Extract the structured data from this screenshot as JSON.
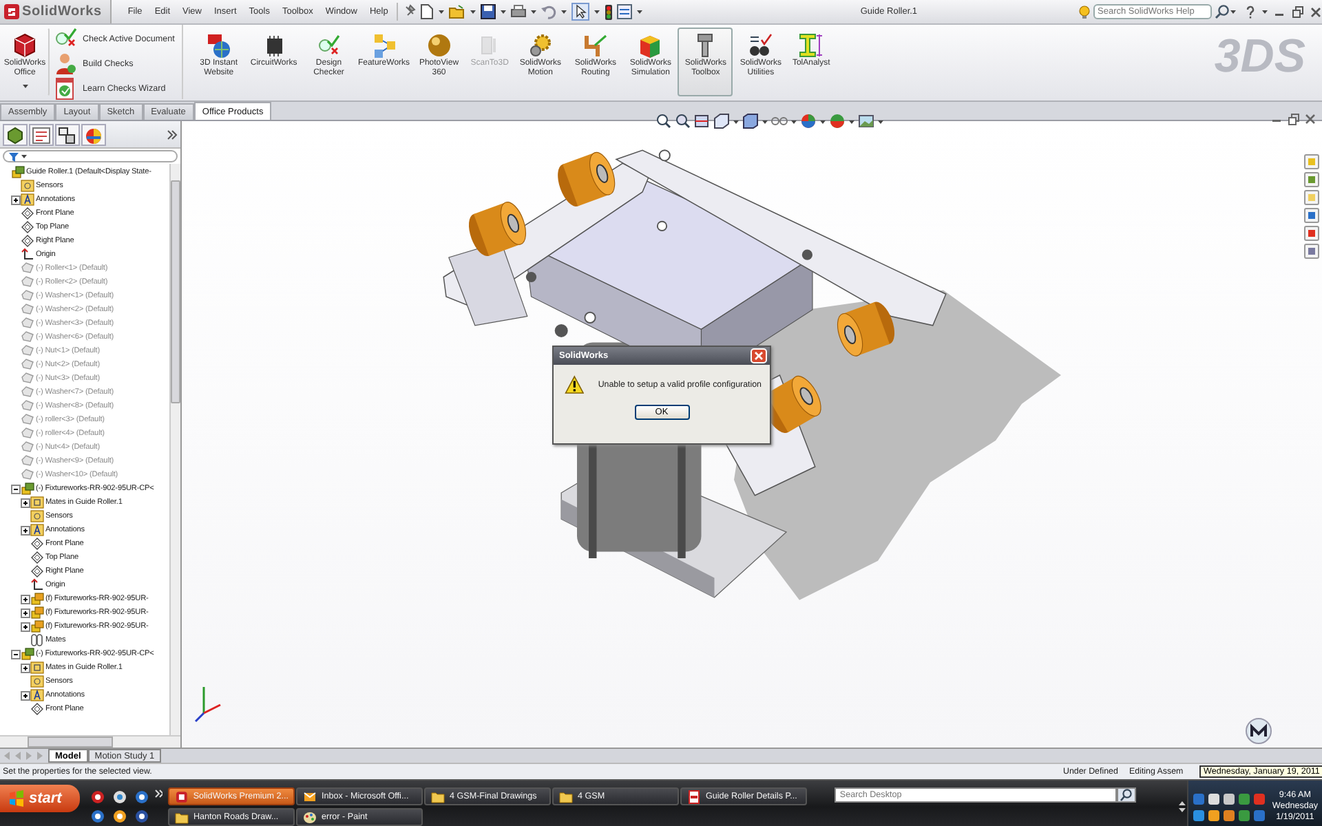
{
  "title_bar": {
    "app_name": "SolidWorks",
    "menu": [
      "File",
      "Edit",
      "View",
      "Insert",
      "Tools",
      "Toolbox",
      "Window",
      "Help"
    ],
    "document_title": "Guide Roller.1",
    "search": {
      "placeholder": "Search SolidWorks Help"
    }
  },
  "ribbon": {
    "office_button": "SolidWorks Office",
    "checks": [
      {
        "label": "Check Active Document",
        "kind": "check"
      },
      {
        "label": "Build Checks",
        "kind": "build"
      },
      {
        "label": "Learn Checks Wizard",
        "kind": "learn"
      }
    ],
    "tools": [
      {
        "label": "3D Instant Website",
        "kind": "website",
        "selected": false,
        "disabled": false
      },
      {
        "label": "CircuitWorks",
        "kind": "circuit",
        "selected": false,
        "disabled": false
      },
      {
        "label": "Design Checker",
        "kind": "checker",
        "selected": false,
        "disabled": false
      },
      {
        "label": "FeatureWorks",
        "kind": "featureworks",
        "selected": false,
        "disabled": false
      },
      {
        "label": "PhotoView 360",
        "kind": "render",
        "selected": false,
        "disabled": false
      },
      {
        "label": "ScanTo3D",
        "kind": "scan",
        "selected": false,
        "disabled": true
      },
      {
        "label": "SolidWorks Motion",
        "kind": "motion",
        "selected": false,
        "disabled": false
      },
      {
        "label": "SolidWorks Routing",
        "kind": "routing",
        "selected": false,
        "disabled": false
      },
      {
        "label": "SolidWorks Simulation",
        "kind": "simulation",
        "selected": false,
        "disabled": false
      },
      {
        "label": "SolidWorks Toolbox",
        "kind": "toolbox",
        "selected": true,
        "disabled": false
      },
      {
        "label": "SolidWorks Utilities",
        "kind": "utilities",
        "selected": false,
        "disabled": false
      },
      {
        "label": "TolAnalyst",
        "kind": "tolerance",
        "selected": false,
        "disabled": false
      }
    ],
    "brand_mark": "3DS"
  },
  "tabs": [
    {
      "label": "Assembly",
      "selected": false
    },
    {
      "label": "Layout",
      "selected": false
    },
    {
      "label": "Sketch",
      "selected": false
    },
    {
      "label": "Evaluate",
      "selected": false
    },
    {
      "label": "Office Products",
      "selected": true
    }
  ],
  "feature_tree": {
    "items": [
      {
        "label": "Guide Roller.1  (Default<Display State-",
        "kind": "assembly",
        "children": [
          {
            "label": "Sensors",
            "kind": "folder"
          },
          {
            "label": "Annotations",
            "kind": "annotation",
            "expanded": false
          },
          {
            "label": "Front Plane",
            "kind": "plane"
          },
          {
            "label": "Top Plane",
            "kind": "plane"
          },
          {
            "label": "Right Plane",
            "kind": "plane"
          },
          {
            "label": "Origin",
            "kind": "origin"
          },
          {
            "label": "(-) Roller<1> (Default)",
            "kind": "part"
          },
          {
            "label": "(-) Roller<2> (Default)",
            "kind": "part"
          },
          {
            "label": "(-) Washer<1> (Default)",
            "kind": "part"
          },
          {
            "label": "(-) Washer<2> (Default)",
            "kind": "part"
          },
          {
            "label": "(-) Washer<3> (Default)",
            "kind": "part"
          },
          {
            "label": "(-) Washer<6> (Default)",
            "kind": "part"
          },
          {
            "label": "(-) Nut<1> (Default)",
            "kind": "part"
          },
          {
            "label": "(-) Nut<2> (Default)",
            "kind": "part"
          },
          {
            "label": "(-) Nut<3> (Default)",
            "kind": "part"
          },
          {
            "label": "(-) Washer<7> (Default)",
            "kind": "part"
          },
          {
            "label": "(-) Washer<8> (Default)",
            "kind": "part"
          },
          {
            "label": "(-) roller<3> (Default)",
            "kind": "part"
          },
          {
            "label": "(-) roller<4> (Default)",
            "kind": "part"
          },
          {
            "label": "(-) Nut<4> (Default)",
            "kind": "part"
          },
          {
            "label": "(-) Washer<9> (Default)",
            "kind": "part"
          },
          {
            "label": "(-) Washer<10> (Default)",
            "kind": "part"
          },
          {
            "label": "(-) Fixtureworks-RR-902-95UR-CP<",
            "kind": "assembly",
            "expanded": true,
            "children": [
              {
                "label": "Mates in Guide Roller.1",
                "kind": "mates-folder",
                "expanded": false
              },
              {
                "label": "Sensors",
                "kind": "folder"
              },
              {
                "label": "Annotations",
                "kind": "annotation",
                "expanded": false
              },
              {
                "label": "Front Plane",
                "kind": "plane"
              },
              {
                "label": "Top Plane",
                "kind": "plane"
              },
              {
                "label": "Right Plane",
                "kind": "plane"
              },
              {
                "label": "Origin",
                "kind": "origin"
              },
              {
                "label": "(f) Fixtureworks-RR-902-95UR-",
                "kind": "fixed-part",
                "expanded": false
              },
              {
                "label": "(f) Fixtureworks-RR-902-95UR-",
                "kind": "fixed-part",
                "expanded": false
              },
              {
                "label": "(f) Fixtureworks-RR-902-95UR-",
                "kind": "fixed-part",
                "expanded": false
              },
              {
                "label": "Mates",
                "kind": "mates"
              }
            ]
          },
          {
            "label": "(-) Fixtureworks-RR-902-95UR-CP<",
            "kind": "assembly",
            "expanded": true,
            "children": [
              {
                "label": "Mates in Guide Roller.1",
                "kind": "mates-folder",
                "expanded": false
              },
              {
                "label": "Sensors",
                "kind": "folder"
              },
              {
                "label": "Annotations",
                "kind": "annotation",
                "expanded": false
              },
              {
                "label": "Front Plane",
                "kind": "plane"
              }
            ]
          }
        ]
      }
    ]
  },
  "dialog": {
    "title": "SolidWorks",
    "message": "Unable to setup a valid profile configuration",
    "button": "OK"
  },
  "bottom_tabs": [
    {
      "label": "Model",
      "selected": true
    },
    {
      "label": "Motion Study 1",
      "selected": false
    }
  ],
  "status_bar": {
    "message": "Set the properties for the selected view.",
    "state": "Under Defined",
    "mode": "Editing Assem"
  },
  "taskbar": {
    "start": "start",
    "tasks": [
      {
        "label": "SolidWorks Premium 2...",
        "kind": "app",
        "selected": true
      },
      {
        "label": "Inbox - Microsoft Offi...",
        "kind": "mail",
        "selected": false
      },
      {
        "label": "4 GSM-Final Drawings",
        "kind": "folder",
        "selected": false
      },
      {
        "label": "4 GSM",
        "kind": "folder",
        "selected": false
      },
      {
        "label": "Guide Roller Details P...",
        "kind": "pdf",
        "selected": false
      },
      {
        "label": "Hanton Roads Draw...",
        "kind": "folder",
        "selected": false
      },
      {
        "label": "error - Paint",
        "kind": "paint",
        "selected": false
      }
    ],
    "search": {
      "placeholder": "Search Desktop"
    },
    "clock": {
      "time": "9:46 AM",
      "day": "Wednesday",
      "date": "1/19/2011"
    },
    "tooltip": "Wednesday, January 19, 2011"
  }
}
